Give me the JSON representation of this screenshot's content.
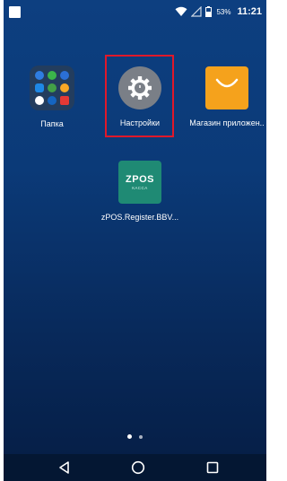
{
  "status_bar": {
    "battery_percent": "53%",
    "time": "11:21",
    "icons": [
      "notification-icon",
      "wifi-icon",
      "signal-icon",
      "battery-icon"
    ]
  },
  "apps": [
    {
      "name": "folder",
      "label": "Папка",
      "icon": "folder-icon"
    },
    {
      "name": "settings",
      "label": "Настройки",
      "icon": "gear-icon"
    },
    {
      "name": "app-store",
      "label": "Магазин приложен..",
      "icon": "shopping-bag-icon"
    },
    {
      "name": "zpos-register",
      "label": "zPOS.Register.BBV...",
      "icon": "zpos-icon",
      "icon_text": "ZPOS",
      "icon_subtext": "КАССА"
    }
  ],
  "highlight": {
    "target": "settings",
    "color": "#e0182a"
  },
  "page_indicator": {
    "pages": 2,
    "current": 1
  },
  "nav_bar": {
    "buttons": [
      "back-icon",
      "home-icon",
      "recents-icon"
    ]
  },
  "colors": {
    "wallpaper": "#0b3a78",
    "nav_bar": "#041733",
    "store_orange": "#f5a21c",
    "zpos_green": "#1f8a74",
    "settings_gray": "#7a7f87"
  }
}
